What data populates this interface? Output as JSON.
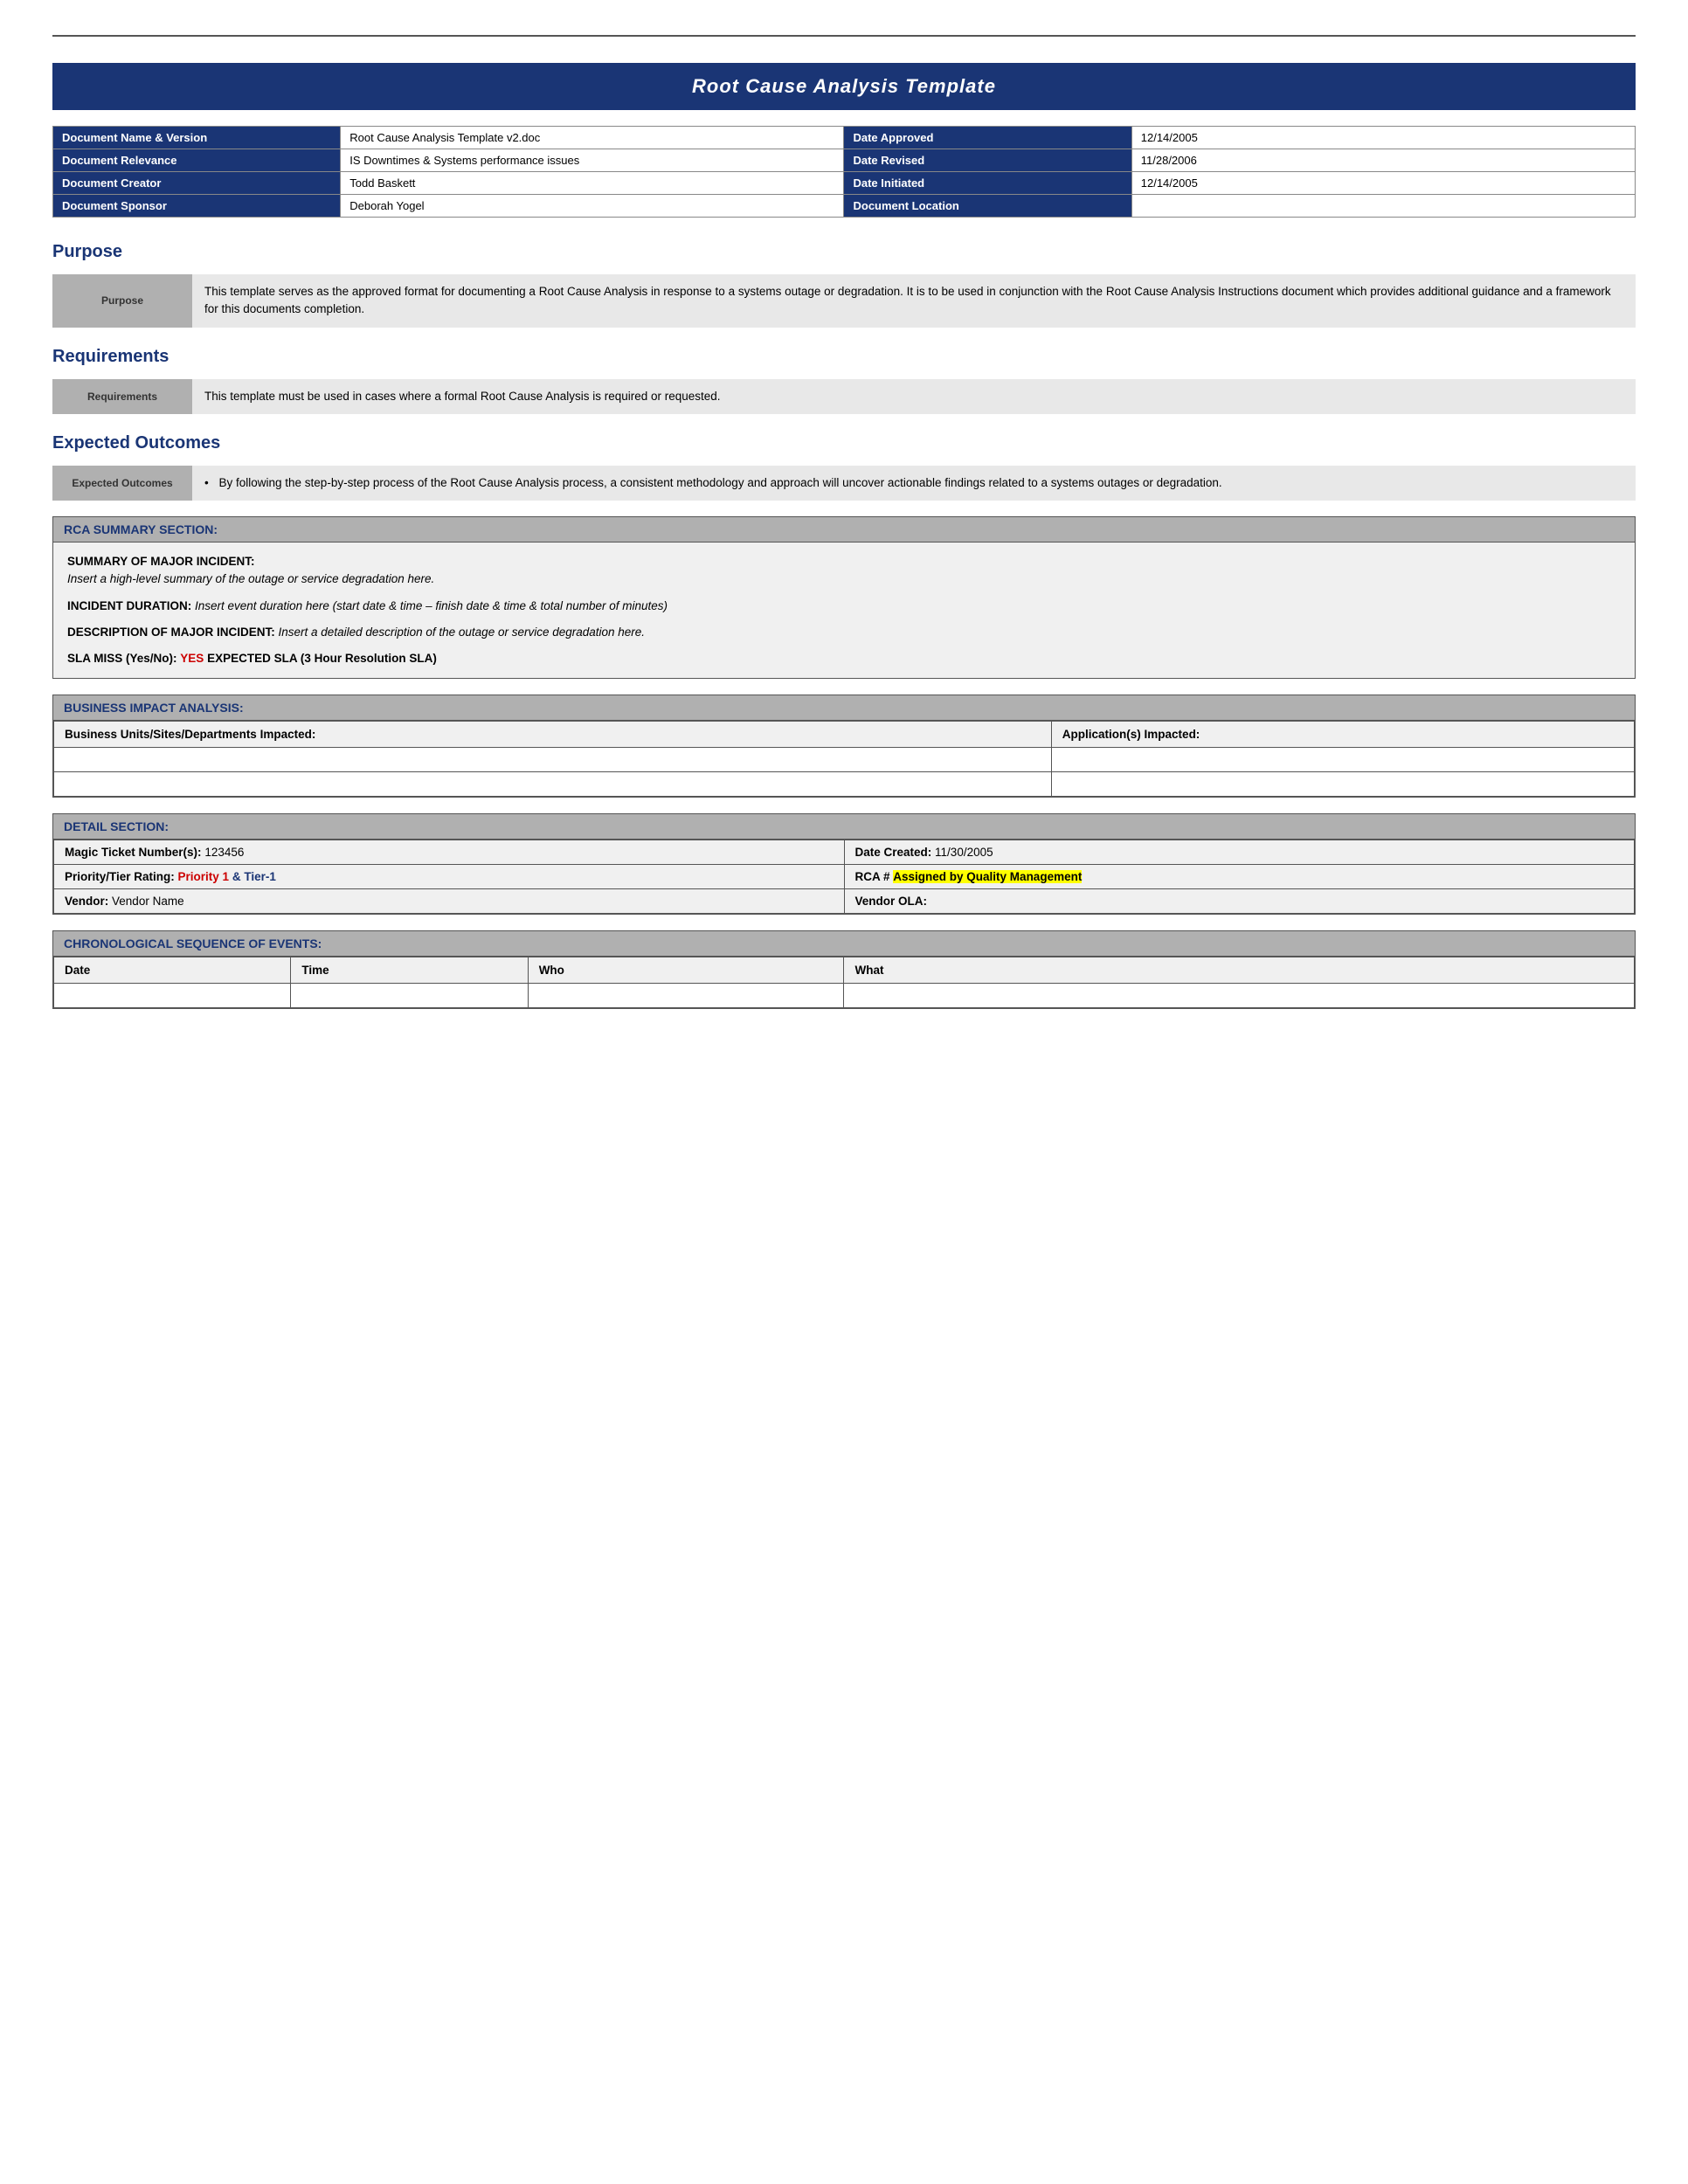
{
  "header": {
    "title": "Root Cause Analysis Template"
  },
  "doc_info": {
    "rows": [
      {
        "left_label": "Document Name & Version",
        "left_value": "Root Cause Analysis Template v2.doc",
        "right_label": "Date Approved",
        "right_value": "12/14/2005"
      },
      {
        "left_label": "Document Relevance",
        "left_value": "IS Downtimes & Systems performance issues",
        "right_label": "Date Revised",
        "right_value": "11/28/2006"
      },
      {
        "left_label": "Document Creator",
        "left_value": "Todd Baskett",
        "right_label": "Date Initiated",
        "right_value": "12/14/2005"
      },
      {
        "left_label": "Document Sponsor",
        "left_value": "Deborah Yogel",
        "right_label": "Document Location",
        "right_value": ""
      }
    ]
  },
  "purpose": {
    "heading": "Purpose",
    "label": "Purpose",
    "text": "This template serves as the approved format for documenting a Root Cause Analysis in response to a systems outage or degradation. It is to be used in conjunction with the Root Cause Analysis Instructions document which provides additional guidance and a framework for this documents completion."
  },
  "requirements": {
    "heading": "Requirements",
    "label": "Requirements",
    "text": "This template must be used in cases where a formal Root Cause Analysis is required or requested."
  },
  "expected_outcomes": {
    "heading": "Expected Outcomes",
    "label": "Expected Outcomes",
    "bullet": "By following the step-by-step process of the Root Cause Analysis process, a consistent methodology and approach will uncover actionable findings related to a systems outages or degradation."
  },
  "rca_summary": {
    "section_header": "RCA SUMMARY SECTION:",
    "summary_label": "SUMMARY OF MAJOR INCIDENT:",
    "summary_text": "Insert a high-level summary of the outage or service degradation here.",
    "incident_label": "INCIDENT DURATION:",
    "incident_text": "Insert event duration here (start date &  time – finish date & time & total number of minutes)",
    "description_label": "DESCRIPTION OF MAJOR INCIDENT:",
    "description_text": "Insert a detailed description of the outage or service degradation here.",
    "sla_label": "SLA MISS (Yes/No):",
    "sla_value": "YES",
    "sla_suffix": "   EXPECTED SLA (3 Hour Resolution SLA)"
  },
  "business_impact": {
    "section_header": "BUSINESS IMPACT ANALYSIS:",
    "col1": "Business Units/Sites/Departments Impacted:",
    "col2": "Application(s) Impacted:"
  },
  "detail": {
    "section_header": "DETAIL SECTION:",
    "ticket_label": "Magic Ticket Number(s):",
    "ticket_value": "123456",
    "date_created_label": "Date Created:",
    "date_created_value": "11/30/2005",
    "priority_label": "Priority/Tier Rating:",
    "priority_value": "Priority 1",
    "tier_connector": " & ",
    "tier_value": "Tier-1",
    "rca_label": "RCA #",
    "rca_value": "Assigned by Quality Management",
    "vendor_label": "Vendor:",
    "vendor_value": "Vendor Name",
    "vendor_ola_label": "Vendor OLA:"
  },
  "chronological": {
    "section_header": "CHRONOLOGICAL SEQUENCE OF EVENTS:",
    "columns": [
      "Date",
      "Time",
      "Who",
      "What"
    ]
  }
}
